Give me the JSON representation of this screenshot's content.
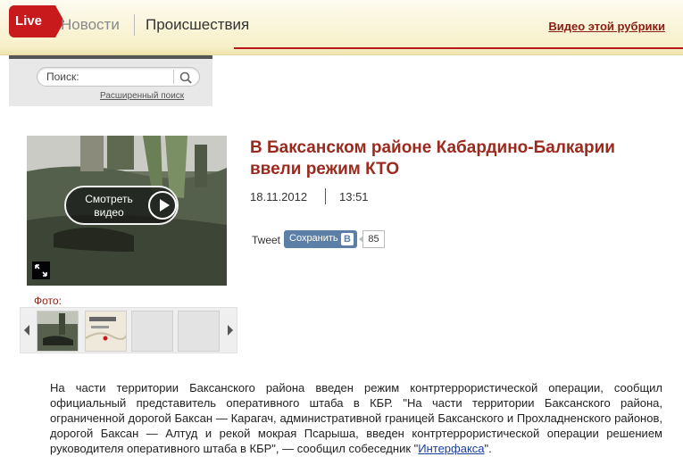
{
  "header": {
    "live_badge": "Live",
    "nav_news": "Новости",
    "nav_section": "Происшествия",
    "video_link": "Видео этой рубрики"
  },
  "search": {
    "label": "Поиск:",
    "value": "",
    "advanced_link": "Расширенный поиск"
  },
  "media": {
    "play_label": "Смотреть видео",
    "photo_label": "Фото:",
    "thumbnail_count": 4
  },
  "article": {
    "headline": "В Баксанском районе Кабардино-Балкарии ввели режим КТО",
    "date": "18.11.2012",
    "time": "13:51",
    "body_text": "На части территории Баксанского района введен режим контртеррористической операции, сообщил официальный представитель оперативного штаба в КБР. \"На части территории Баксанского района, ограниченной дорогой Баксан — Карагач, административной границей Баксанского и Прохладненского районов, дорогой Баксан — Алтуд и рекой мокрая Псарыша, введен контртеррористической операции решением руководителя оперативного штаба в КБР\", — сообщил собеседник \"",
    "source_link": "Интерфакса",
    "body_tail": "\"."
  },
  "social": {
    "tweet_label": "Tweet",
    "vk_save_label": "Сохранить",
    "vk_logo": "В",
    "vk_count": "85"
  },
  "colors": {
    "accent_red": "#c8191c",
    "headline": "#9b2a1e",
    "link_blue": "#1a3f9c",
    "vk_blue": "#5b7fa6"
  }
}
